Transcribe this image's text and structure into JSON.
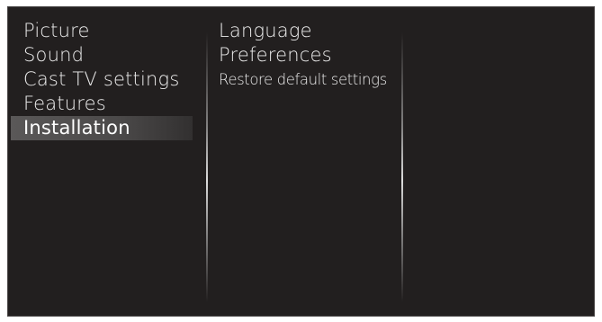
{
  "main_menu": {
    "items": [
      {
        "label": "Picture"
      },
      {
        "label": "Sound"
      },
      {
        "label": "Cast TV settings"
      },
      {
        "label": "Features"
      },
      {
        "label": "Installation",
        "selected": true
      }
    ]
  },
  "sub_menu": {
    "items": [
      {
        "label": "Language"
      },
      {
        "label": "Preferences"
      },
      {
        "label": "Restore default settings"
      }
    ]
  },
  "colors": {
    "background": "#221f1f",
    "text": "#ececec",
    "highlight": "#545252"
  }
}
